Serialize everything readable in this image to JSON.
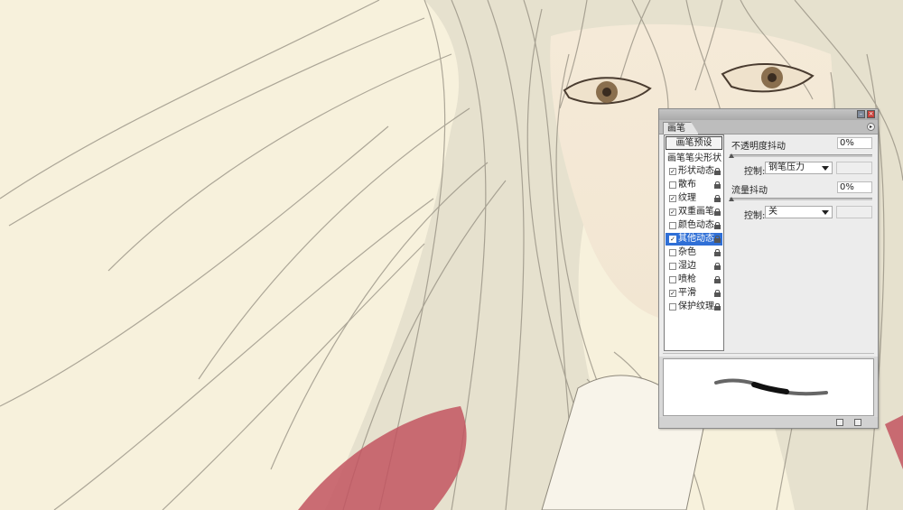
{
  "panel": {
    "tab_label": "画笔",
    "preset_button": "画笔预设",
    "tip_shape_label": "画笔笔尖形状",
    "options": [
      {
        "label": "形状动态",
        "checked": true,
        "selected": false
      },
      {
        "label": "散布",
        "checked": false,
        "selected": false
      },
      {
        "label": "纹理",
        "checked": true,
        "selected": false
      },
      {
        "label": "双重画笔",
        "checked": true,
        "selected": false
      },
      {
        "label": "颜色动态",
        "checked": false,
        "selected": false
      },
      {
        "label": "其他动态",
        "checked": true,
        "selected": true
      },
      {
        "label": "杂色",
        "checked": false,
        "selected": false
      },
      {
        "label": "湿边",
        "checked": false,
        "selected": false
      },
      {
        "label": "喷枪",
        "checked": false,
        "selected": false
      },
      {
        "label": "平滑",
        "checked": true,
        "selected": false
      },
      {
        "label": "保护纹理",
        "checked": false,
        "selected": false
      }
    ],
    "opacity_jitter": {
      "label": "不透明度抖动",
      "value": "0%"
    },
    "opacity_control": {
      "label": "控制:",
      "value": "钢笔压力"
    },
    "flow_jitter": {
      "label": "流量抖动",
      "value": "0%"
    },
    "flow_control": {
      "label": "控制:",
      "value": "关"
    }
  },
  "colors": {
    "selected": "#2f6fd6",
    "canvas": "#f7f1dc",
    "close": "#c8403a"
  }
}
